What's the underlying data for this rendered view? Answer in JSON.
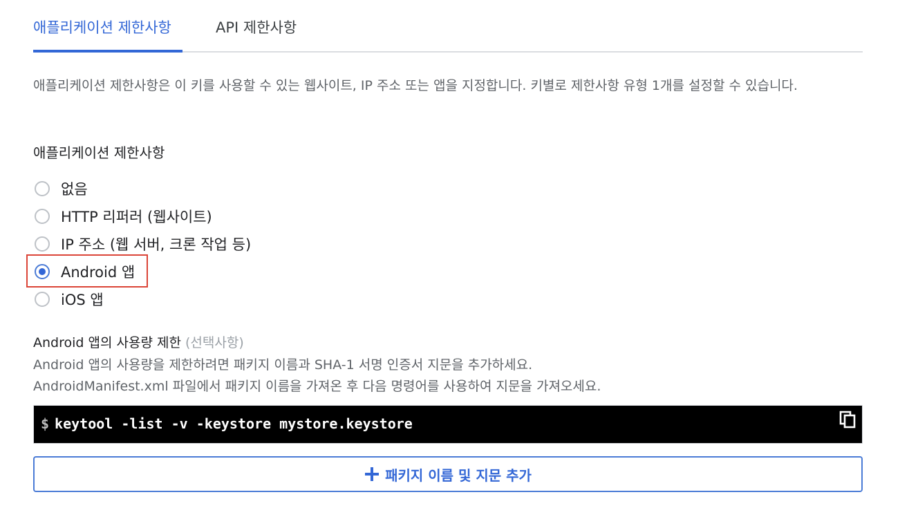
{
  "tabs": [
    {
      "label": "애플리케이션 제한사항",
      "active": true
    },
    {
      "label": "API 제한사항",
      "active": false
    }
  ],
  "description": "애플리케이션 제한사항은 이 키를 사용할 수 있는 웹사이트, IP 주소 또는 앱을 지정합니다. 키별로 제한사항 유형 1개를 설정할 수 있습니다.",
  "restriction_section": {
    "title": "애플리케이션 제한사항",
    "options": [
      {
        "label": "없음",
        "checked": false
      },
      {
        "label": "HTTP 리퍼러 (웹사이트)",
        "checked": false
      },
      {
        "label": "IP 주소 (웹 서버, 크론 작업 등)",
        "checked": false
      },
      {
        "label": "Android 앱",
        "checked": true
      },
      {
        "label": "iOS 앱",
        "checked": false
      }
    ]
  },
  "android_section": {
    "title": "Android 앱의 사용량 제한",
    "optional_label": "(선택사항)",
    "line1": "Android 앱의 사용량을 제한하려면 패키지 이름과 SHA-1 서명 인증서 지문을 추가하세요.",
    "line2": "AndroidManifest.xml 파일에서 패키지 이름을 가져온 후 다음 명령어를 사용하여 지문을 가져오세요.",
    "code_prompt": "$",
    "code_command": "keytool -list -v -keystore mystore.keystore",
    "copy_icon": "copy-icon",
    "add_button_label": "패키지 이름 및 지문 추가",
    "add_icon": "plus-icon"
  },
  "colors": {
    "accent": "#3367d6",
    "highlight_border": "#db4437",
    "code_background": "#000000"
  }
}
